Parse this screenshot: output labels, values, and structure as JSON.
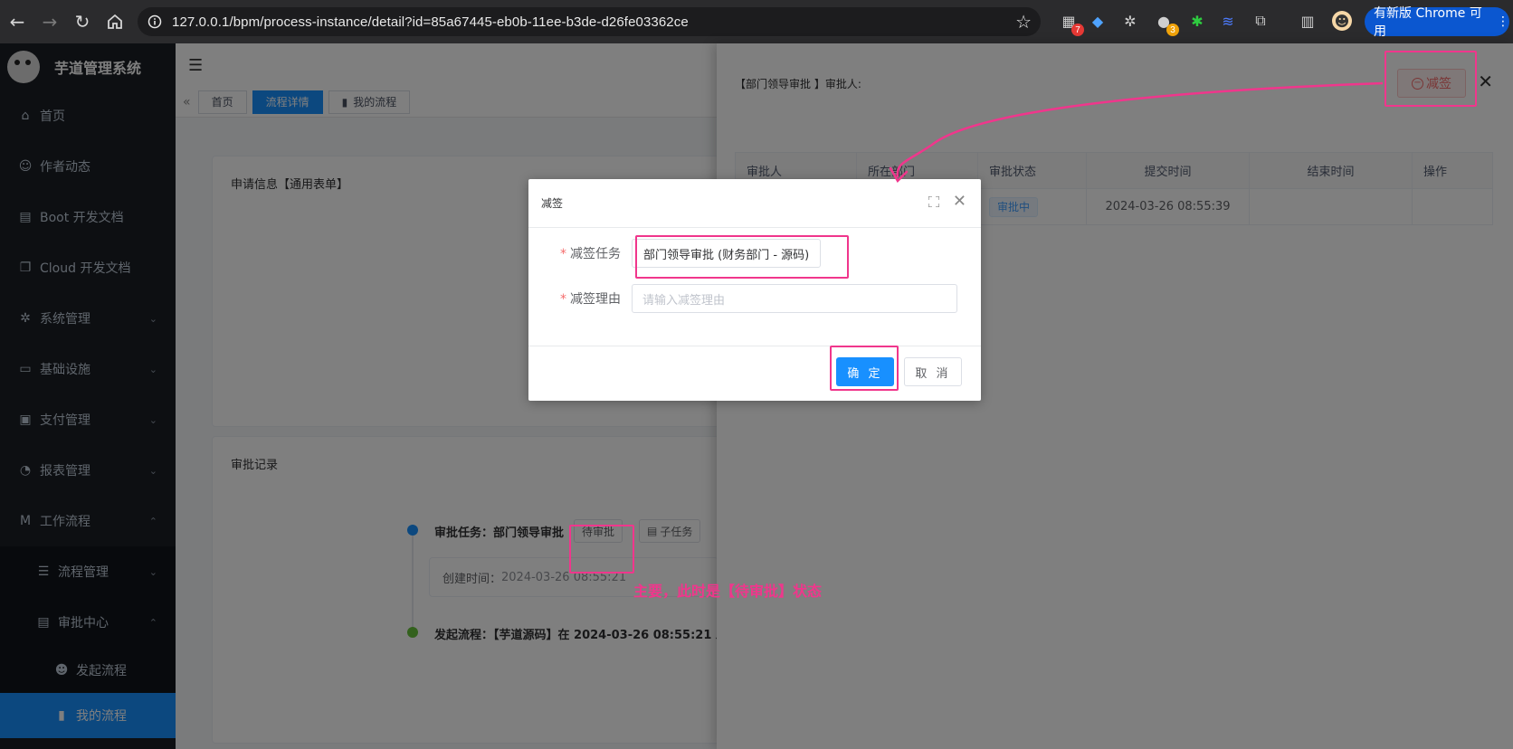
{
  "browser": {
    "url": "127.0.0.1/bpm/process-instance/detail?id=85a67445-eb0b-11ee-b3de-d26fe03362ce",
    "update_label": "有新版 Chrome 可用",
    "ext_badges": [
      "7",
      "3"
    ]
  },
  "sidebar": {
    "app_title": "芋道管理系统",
    "items": [
      {
        "label": "首页",
        "icon": "home-icon"
      },
      {
        "label": "作者动态",
        "icon": "user-icon"
      },
      {
        "label": "Boot 开发文档",
        "icon": "document-icon"
      },
      {
        "label": "Cloud 开发文档",
        "icon": "copy-icon"
      },
      {
        "label": "系统管理",
        "icon": "gear-icon"
      },
      {
        "label": "基础设施",
        "icon": "monitor-icon"
      },
      {
        "label": "支付管理",
        "icon": "wallet-icon"
      },
      {
        "label": "报表管理",
        "icon": "chart-icon"
      },
      {
        "label": "工作流程",
        "icon": "workflow-icon"
      },
      {
        "label": "流程管理",
        "icon": "list-icon"
      },
      {
        "label": "审批中心",
        "icon": "server-icon"
      },
      {
        "label": "发起流程",
        "icon": "smile-icon"
      },
      {
        "label": "我的流程",
        "icon": "book-icon"
      }
    ]
  },
  "tags": {
    "home": "首页",
    "process_detail": "流程详情",
    "my_process": "我的流程"
  },
  "main": {
    "apply_info_title": "申请信息【通用表单】",
    "approval_record_title": "审批记录",
    "timeline": {
      "task_label": "审批任务：部门领导审批",
      "pending_btn": "待审批",
      "subtask_btn": "子任务",
      "created_label": "创建时间：",
      "created_time": "2024-03-26 08:55:21",
      "start_label": "发起流程：【芋道源码】在 2024-03-26 08:55:21 发"
    }
  },
  "drawer": {
    "title": "【部门领导审批 】审批人:",
    "reduce_btn": "减签",
    "table": {
      "headers": [
        "审批人",
        "所在部门",
        "审批状态",
        "提交时间",
        "结束时间",
        "操作"
      ],
      "rows": [
        {
          "approver": "",
          "dept": "",
          "status": "审批中",
          "submit_time": "2024-03-26 08:55:39",
          "end_time": "",
          "op": ""
        }
      ]
    }
  },
  "dialog": {
    "title": "减签",
    "task_label": "减签任务",
    "task_value": "部门领导审批 (财务部门 - 源码)",
    "reason_label": "减签理由",
    "reason_placeholder": "请输入减签理由",
    "confirm": "确 定",
    "cancel": "取 消"
  },
  "annotation": {
    "note": "主要，此时是【待审批】状态",
    "color": "#f0368c"
  }
}
